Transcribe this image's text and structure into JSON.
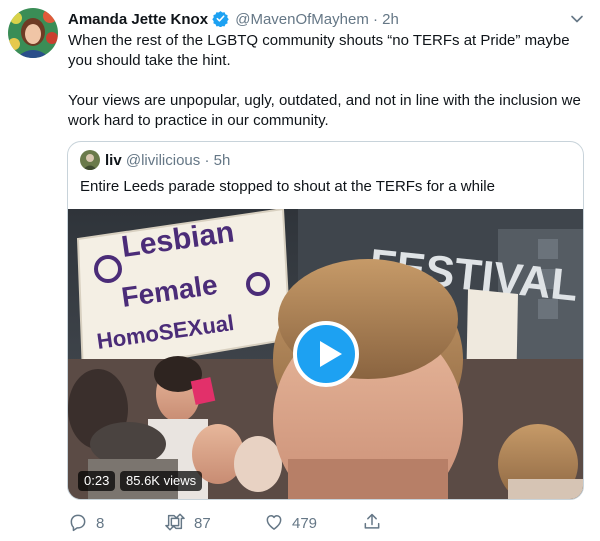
{
  "tweet": {
    "author_name": "Amanda Jette Knox",
    "author_handle": "@MavenOfMayhem",
    "separator": "·",
    "time": "2h",
    "text_para1": "When the rest of the LGBTQ community shouts “no TERFs at Pride” maybe you should take the hint.",
    "text_para2": "Your views are unpopular, ugly, outdated, and not in line with the inclusion we work hard to practice in our community."
  },
  "quote": {
    "author_name": "liv",
    "author_handle": "@livilicious",
    "separator": "·",
    "time": "5h",
    "text": "Entire Leeds parade stopped to shout at the TERFs for a while",
    "video": {
      "duration": "0:23",
      "views": "85.6K views",
      "sign_lines": [
        "Lesbian",
        "Female",
        "HomoSEXual"
      ],
      "background_text": "FESTIVAL"
    }
  },
  "actions": {
    "replies": "8",
    "retweets": "87",
    "likes": "479"
  },
  "colors": {
    "accent": "#1da1f2",
    "text": "#0f1419",
    "secondary_text": "#657786",
    "border": "#c8d3da",
    "icon": "#657786"
  },
  "icons": [
    "verified-badge-icon",
    "chevron-down-icon",
    "play-icon",
    "reply-icon",
    "retweet-icon",
    "like-icon",
    "share-icon"
  ]
}
